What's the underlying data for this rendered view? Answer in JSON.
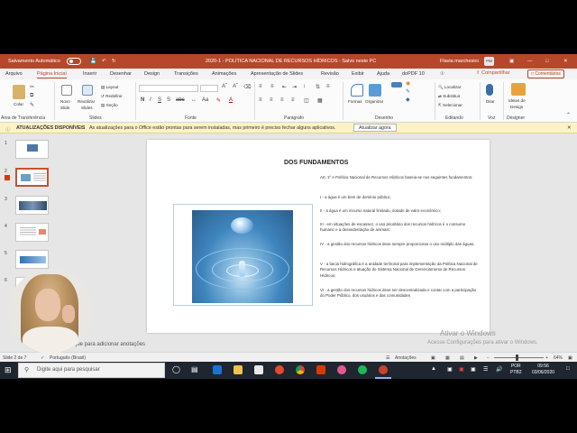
{
  "titlebar": {
    "autosave": "Salvamento Automático",
    "doc_title": "2020-1 - POLÍTICA NACIONAL DE RECURSOS HÍDRICOS - Salvo neste PC",
    "user_name": "Flavia marchesini",
    "user_initials": "FM"
  },
  "tabs": [
    "Arquivo",
    "Página Inicial",
    "Inserir",
    "Desenhar",
    "Design",
    "Transições",
    "Animações",
    "Apresentação de Slides",
    "Revisão",
    "Exibir",
    "Ajuda",
    "doPDF 10",
    "Diga-me"
  ],
  "share_label": "Compartilhar",
  "comments_label": "Comentários",
  "ribbon": {
    "clipboard": {
      "paste": "Colar",
      "group": "Área de Transferência"
    },
    "slides": {
      "new": "Novo",
      "new2": "Slide",
      "reuse": "Reutilizar",
      "reuse2": "Slides",
      "layout": "Layout",
      "reset": "Redefinir",
      "section": "Seção",
      "group": "Slides"
    },
    "font": {
      "group": "Fonte"
    },
    "paragraph": {
      "group": "Parágrafo"
    },
    "drawing": {
      "shapes": "Formas",
      "arrange": "Organizar",
      "group": "Desenho"
    },
    "editing": {
      "find": "Localizar",
      "replace": "Substituir",
      "select": "Selecionar",
      "group": "Editando"
    },
    "voice": {
      "dictate": "Ditar",
      "group": "Voz"
    },
    "designer": {
      "ideas": "Ideias de",
      "ideas2": "Design",
      "group": "Designer"
    }
  },
  "update_bar": {
    "label": "ATUALIZAÇÕES DISPONÍVEIS",
    "message": "As atualizações para o Office estão prontas para serem instaladas, mas primeiro é preciso fechar alguns aplicativos.",
    "button": "Atualizar agora"
  },
  "thumb_numbers": [
    "1",
    "2",
    "3",
    "4",
    "5",
    "6"
  ],
  "slide": {
    "title": "DOS FUNDAMENTOS",
    "paragraphs": [
      "Art. 1º A Política Nacional de Recursos Hídricos baseia-se nos seguintes fundamentos:",
      "I - a água é um bem de domínio público;",
      "II - a água é um recurso natural limitado, dotado de valor econômico;",
      "III - em situações de escassez, o uso prioritário dos recursos hídricos é o consumo humano e a dessedentação de animais;",
      "IV - a gestão dos recursos hídricos deve sempre proporcionar o uso múltiplo das águas;",
      "V - a bacia hidrográfica é a unidade territorial para implementação da Política Nacional de Recursos Hídricos e atuação do Sistema Nacional de Gerenciamento de Recursos Hídricos;",
      "VI - a gestão dos recursos hídricos deve ser descentralizada e contar com a participação do Poder Público, dos usuários e das comunidades"
    ]
  },
  "notes_placeholder": "que para adicionar anotações",
  "status": {
    "slide_count": "Slide 2 de 7",
    "language": "Português (Brasil)",
    "notes": "Anotações",
    "zoom": "64%"
  },
  "watermark": {
    "line1": "Ativar o Windows",
    "line2": "Acesse Configurações para ativar o Windows."
  },
  "taskbar": {
    "search_placeholder": "Digite aqui para pesquisar",
    "lang1": "POR",
    "lang2": "PTB2",
    "time": "09:56",
    "date": "03/06/2020"
  }
}
